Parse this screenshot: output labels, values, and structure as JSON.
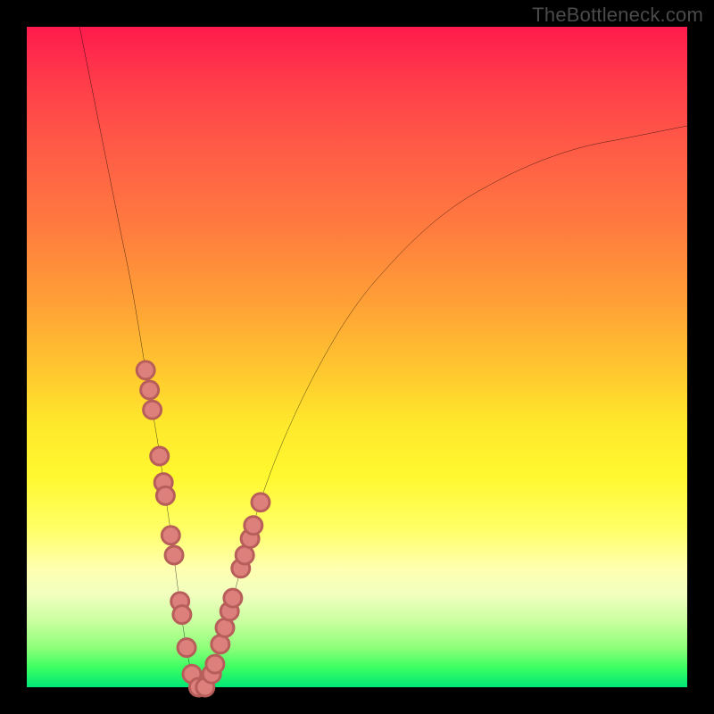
{
  "watermark": "TheBottleneck.com",
  "chart_data": {
    "type": "line",
    "title": "",
    "xlabel": "",
    "ylabel": "",
    "xlim": [
      0,
      100
    ],
    "ylim": [
      0,
      100
    ],
    "grid": false,
    "series": [
      {
        "name": "curve",
        "x": [
          8,
          10,
          12,
          14,
          16,
          18,
          19,
          20,
          21,
          22,
          23,
          24,
          25,
          26,
          27,
          28,
          30,
          33,
          36,
          40,
          45,
          50,
          55,
          60,
          65,
          70,
          75,
          80,
          85,
          90,
          95,
          100
        ],
        "y": [
          100,
          90,
          80,
          70,
          60,
          48,
          42,
          36,
          29,
          22,
          14,
          7,
          2,
          0,
          0,
          2,
          9,
          20,
          30,
          40,
          50,
          58,
          64,
          69,
          73,
          76,
          78.5,
          80.5,
          82,
          83,
          84,
          85
        ],
        "color": "#000000"
      }
    ],
    "markers": {
      "name": "dots",
      "color": "#dd7f7b",
      "points": [
        {
          "x": 18.0,
          "y": 48
        },
        {
          "x": 18.6,
          "y": 45
        },
        {
          "x": 19.0,
          "y": 42
        },
        {
          "x": 20.1,
          "y": 35
        },
        {
          "x": 20.7,
          "y": 31
        },
        {
          "x": 21.0,
          "y": 29
        },
        {
          "x": 21.8,
          "y": 23
        },
        {
          "x": 22.3,
          "y": 20
        },
        {
          "x": 23.2,
          "y": 13
        },
        {
          "x": 23.5,
          "y": 11
        },
        {
          "x": 24.2,
          "y": 6
        },
        {
          "x": 25.0,
          "y": 2
        },
        {
          "x": 26.0,
          "y": 0
        },
        {
          "x": 27.0,
          "y": 0
        },
        {
          "x": 28.0,
          "y": 2
        },
        {
          "x": 28.5,
          "y": 3.5
        },
        {
          "x": 29.3,
          "y": 6.5
        },
        {
          "x": 30.0,
          "y": 9
        },
        {
          "x": 30.7,
          "y": 11.5
        },
        {
          "x": 31.2,
          "y": 13.5
        },
        {
          "x": 32.4,
          "y": 18
        },
        {
          "x": 33.0,
          "y": 20
        },
        {
          "x": 33.8,
          "y": 22.5
        },
        {
          "x": 34.3,
          "y": 24.5
        },
        {
          "x": 35.4,
          "y": 28
        }
      ]
    },
    "background_gradient": {
      "top": "#ff1a4d",
      "bottom": "#00e676"
    }
  }
}
